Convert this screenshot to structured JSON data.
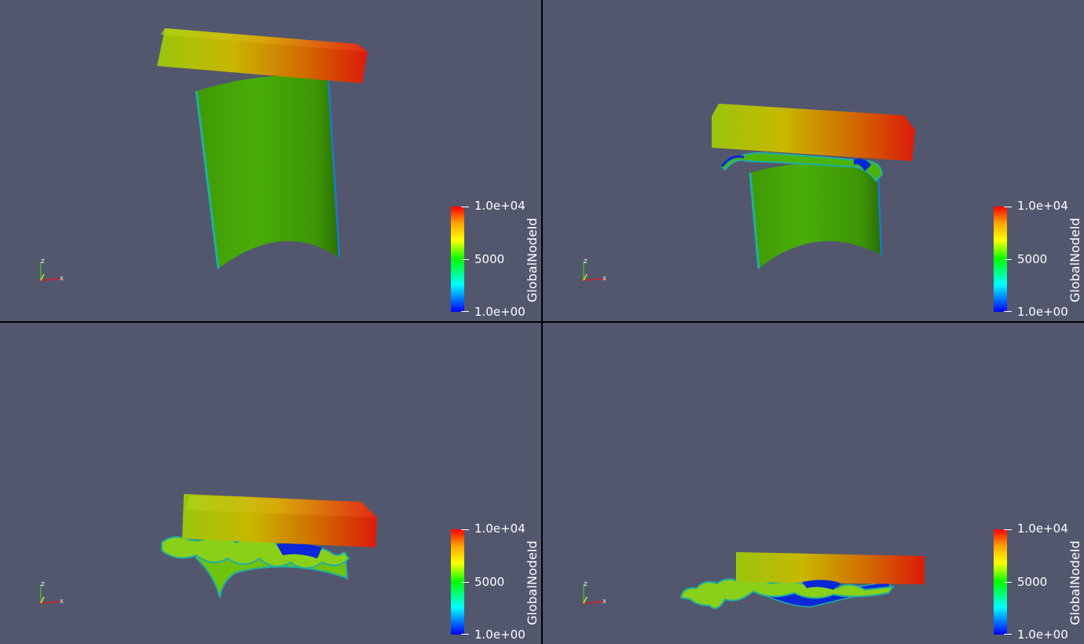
{
  "views": [
    {
      "id": "view-1",
      "legend": {
        "title": "GlobalNodeId",
        "max_label": "1.0e+04",
        "mid_label": "5000",
        "min_label": "1.0e+00"
      }
    },
    {
      "id": "view-2",
      "legend": {
        "title": "GlobalNodeId",
        "max_label": "1.0e+04",
        "mid_label": "5000",
        "min_label": "1.0e+00"
      }
    },
    {
      "id": "view-3",
      "legend": {
        "title": "GlobalNodeId",
        "max_label": "1.0e+04",
        "mid_label": "5000",
        "min_label": "1.0e+00"
      }
    },
    {
      "id": "view-4",
      "legend": {
        "title": "GlobalNodeId",
        "max_label": "1.0e+04",
        "mid_label": "5000",
        "min_label": "1.0e+00"
      }
    }
  ],
  "orientation_axes": {
    "x": "X",
    "z": "Z"
  },
  "colormap": {
    "max": "#ff0000",
    "upper": "#ffff00",
    "mid": "#00ff00",
    "lower": "#00ffff",
    "min": "#0000ff"
  },
  "background": "#52576e"
}
